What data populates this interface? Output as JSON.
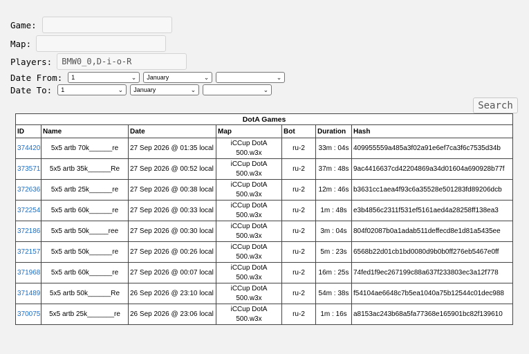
{
  "search_form": {
    "game_label": "Game:",
    "game_value": "",
    "map_label": "Map:",
    "map_value": "",
    "players_label": "Players:",
    "players_value": "BMW0_0,D-i-o-R",
    "date_from_label": "Date From:",
    "date_from": {
      "day": "1",
      "month": "January",
      "year": ""
    },
    "date_to_label": "Date To:",
    "date_to": {
      "day": "1",
      "month": "January",
      "year": ""
    },
    "search_label": "Search"
  },
  "games_table": {
    "caption": "DotA Games",
    "columns": [
      "ID",
      "Name",
      "Date",
      "Map",
      "Bot",
      "Duration",
      "Hash"
    ],
    "rows": [
      {
        "id": "374420",
        "name": "5x5 artb 70k______re",
        "date": "27 Sep 2026 @ 01:35 local",
        "map": "iCCup DotA 500.w3x",
        "bot": "ru-2",
        "duration": "33m : 04s",
        "hash": "409955559a485a3f02a91e6ef7ca3f6c7535d34b"
      },
      {
        "id": "373571",
        "name": "5x5 artb 35k______Re",
        "date": "27 Sep 2026 @ 00:52 local",
        "map": "iCCup DotA 500.w3x",
        "bot": "ru-2",
        "duration": "37m : 48s",
        "hash": "9ac4416637cd42204869a34d01604a690928b77f"
      },
      {
        "id": "372636",
        "name": "5x5 artb 25k______re",
        "date": "27 Sep 2026 @ 00:38 local",
        "map": "iCCup DotA 500.w3x",
        "bot": "ru-2",
        "duration": "12m : 46s",
        "hash": "b3631cc1aea4f93c6a35528e501283fd89206dcb"
      },
      {
        "id": "372254",
        "name": "5x5 artb 60k______re",
        "date": "27 Sep 2026 @ 00:33 local",
        "map": "iCCup DotA 500.w3x",
        "bot": "ru-2",
        "duration": "1m : 48s",
        "hash": "e3b4856c2311f531ef5161aed4a28258ff138ea3"
      },
      {
        "id": "372186",
        "name": "5x5 artb 50k_____ree",
        "date": "27 Sep 2026 @ 00:30 local",
        "map": "iCCup DotA 500.w3x",
        "bot": "ru-2",
        "duration": "3m : 04s",
        "hash": "804f02087b0a1adab511deffecd8e1d81a5435ee"
      },
      {
        "id": "372157",
        "name": "5x5 artb 50k______re",
        "date": "27 Sep 2026 @ 00:26 local",
        "map": "iCCup DotA 500.w3x",
        "bot": "ru-2",
        "duration": "5m : 23s",
        "hash": "6568b22d01cb1bd0080d9b0b0ff276eb5467e0ff"
      },
      {
        "id": "371968",
        "name": "5x5 artb 60k______re",
        "date": "27 Sep 2026 @ 00:07 local",
        "map": "iCCup DotA 500.w3x",
        "bot": "ru-2",
        "duration": "16m : 25s",
        "hash": "74fed1f9ec267199c88a637f233803ec3a12f778"
      },
      {
        "id": "371489",
        "name": "5x5 artb 50k______Re",
        "date": "26 Sep 2026 @ 23:10 local",
        "map": "iCCup DotA 500.w3x",
        "bot": "ru-2",
        "duration": "54m : 38s",
        "hash": "f54104ae6648c7b5ea1040a75b12544c01dec988"
      },
      {
        "id": "370075",
        "name": "5x5 artb 25k_______re",
        "date": "26 Sep 2026 @ 23:06 local",
        "map": "iCCup DotA 500.w3x",
        "bot": "ru-2",
        "duration": "1m : 16s",
        "hash": "a8153ac243b68a5fa77368e165901bc82f139610"
      }
    ]
  }
}
